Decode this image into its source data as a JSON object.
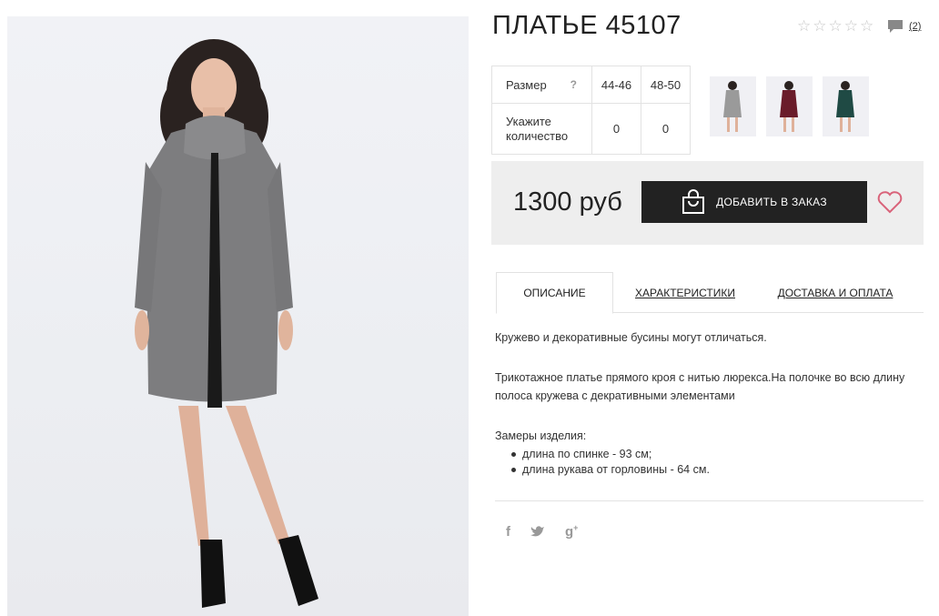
{
  "product": {
    "title": "ПЛАТЬЕ 45107",
    "rating_stars": 5,
    "rating_filled": 0,
    "comment_count": "(2)"
  },
  "sizes": {
    "size_label": "Размер",
    "help": "?",
    "quantity_label": "Укажите количество",
    "options": [
      {
        "size": "44-46",
        "qty": "0"
      },
      {
        "size": "48-50",
        "qty": "0"
      }
    ]
  },
  "thumbnails": [
    {
      "name": "grey-dress",
      "color": "#9a9a9a"
    },
    {
      "name": "burgundy-dress",
      "color": "#6a1c2a"
    },
    {
      "name": "green-dress",
      "color": "#1f4a44"
    }
  ],
  "purchase": {
    "price": "1300 руб",
    "add_button": "ДОБАВИТЬ В ЗАКАЗ",
    "button_color": "#222222",
    "heart_color": "#d9637a"
  },
  "tabs": [
    {
      "label": "ОПИСАНИЕ",
      "active": true
    },
    {
      "label": "ХАРАКТЕРИСТИКИ",
      "active": false
    },
    {
      "label": "ДОСТАВКА И ОПЛАТА",
      "active": false
    }
  ],
  "description": {
    "p1": "Кружево и декоративные бусины могут отличаться.",
    "p2": "Трикотажное платье прямого кроя с нитью люрекса.На полочке во всю длину полоса кружева с декративными элементами",
    "measures_title": "Замеры изделия:",
    "measures": [
      "длина по спинке - 93 см;",
      "длина рукава от горловины - 64 см."
    ]
  },
  "social": [
    "facebook-icon",
    "twitter-icon",
    "google-plus-icon"
  ]
}
